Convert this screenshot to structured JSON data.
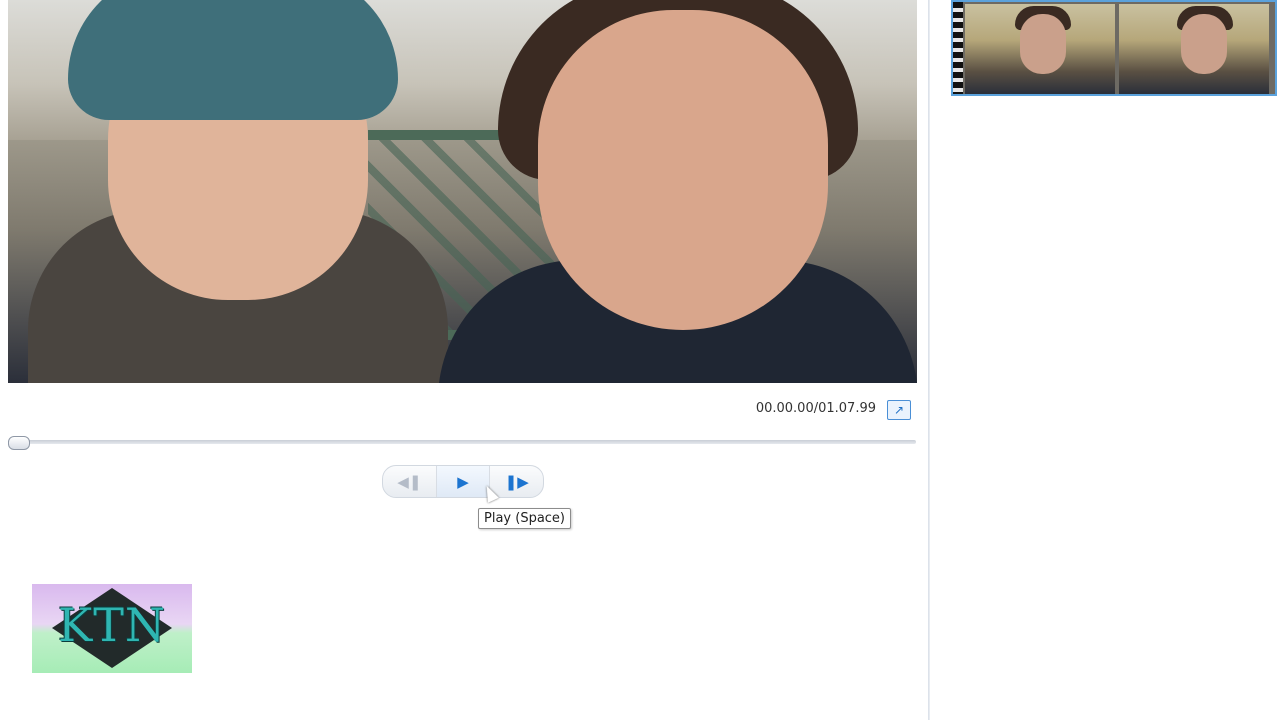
{
  "player": {
    "timecode": "00.00.00/01.07.99",
    "buttons": {
      "previous_icon": "previous-frame-icon",
      "play_icon": "play-icon",
      "next_icon": "next-frame-icon"
    },
    "tooltip": "Play (Space)",
    "seek_position": 0
  },
  "logo": {
    "text": "KTN"
  },
  "storyboard": {
    "clips": [
      {
        "thumbnail": "video-clip-thumbnail",
        "selected": true
      }
    ]
  },
  "colors": {
    "accent": "#1c74d0",
    "selection_border": "#5ba2dc"
  }
}
